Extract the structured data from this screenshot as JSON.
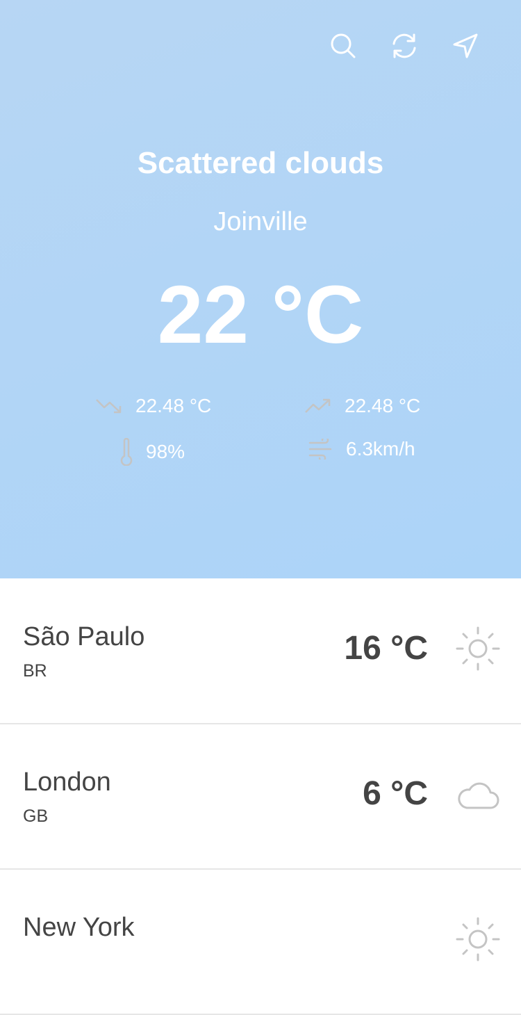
{
  "header": {
    "condition": "Scattered clouds",
    "city": "Joinville",
    "temperature": "22 °C",
    "stats": {
      "min": "22.48 °C",
      "max": "22.48 °C",
      "humidity": "98%",
      "wind": "6.3km/h"
    }
  },
  "icons": {
    "search": "search-icon",
    "refresh": "refresh-icon",
    "location": "location-arrow-icon"
  },
  "cities": [
    {
      "name": "São Paulo",
      "country": "BR",
      "temp": "16 °C",
      "icon": "sun-icon"
    },
    {
      "name": "London",
      "country": "GB",
      "temp": "6 °C",
      "icon": "cloud-icon"
    },
    {
      "name": "New York",
      "country": "",
      "temp": "",
      "icon": "sun-icon"
    }
  ],
  "colors": {
    "hero_gradient_start": "#b7d6f4",
    "hero_gradient_end": "#acd4f8",
    "text_dark": "#444444",
    "icon_gray": "#c4c4c4"
  }
}
